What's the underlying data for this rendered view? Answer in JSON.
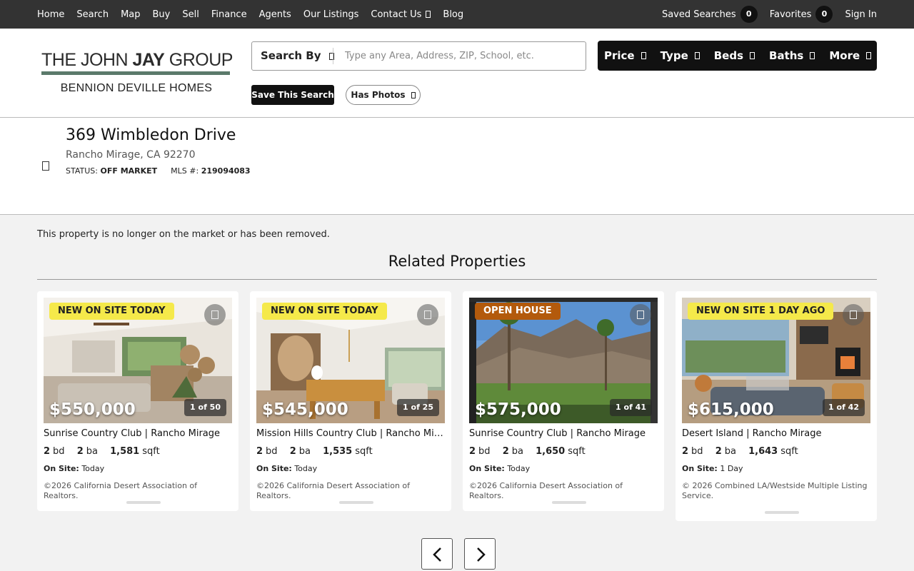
{
  "topnav": {
    "links": [
      "Home",
      "Search",
      "Map",
      "Buy",
      "Sell",
      "Finance",
      "Agents",
      "Our Listings",
      "Contact Us",
      "Blog"
    ],
    "saved_searches_label": "Saved Searches",
    "saved_searches_count": "0",
    "favorites_label": "Favorites",
    "favorites_count": "0",
    "sign_in": "Sign In"
  },
  "logo": {
    "line1_a": "THE JOHN ",
    "line1_b": "JAY",
    "line1_c": " GROUP",
    "line2": "BENNION DEVILLE HOMES"
  },
  "search": {
    "by_label": "Search By",
    "placeholder": "Type any Area, Address, ZIP, School, etc.",
    "value": ""
  },
  "filters": [
    "Price",
    "Type",
    "Beds",
    "Baths",
    "More"
  ],
  "save_search_label": "Save This Search",
  "has_photos_label": "Has Photos",
  "property": {
    "address": "369 Wimbledon Drive",
    "city_line": "Rancho Mirage, CA 92270",
    "status_label": "STATUS:",
    "status_value": "OFF MARKET",
    "mls_label": "MLS #:",
    "mls_value": "219094083"
  },
  "removed_notice": "This property is no longer on the market or has been removed.",
  "related_title": "Related Properties",
  "cards": [
    {
      "tag": "NEW ON SITE TODAY",
      "tag_color": "#f5e94a",
      "tag_text_color": "#222222",
      "price": "$550,000",
      "photo_count": "1 of 50",
      "name": "Sunrise Country Club | Rancho Mirage",
      "beds": "2",
      "beds_unit": "bd",
      "baths": "2",
      "baths_unit": "ba",
      "sqft": "1,581",
      "sqft_unit": "sqft",
      "onsite_label": "On Site:",
      "onsite_value": "Today",
      "copyright": "©2026 California Desert Association of Realtors."
    },
    {
      "tag": "NEW ON SITE TODAY",
      "tag_color": "#f5e94a",
      "tag_text_color": "#222222",
      "price": "$545,000",
      "photo_count": "1 of 25",
      "name": "Mission Hills Country Club | Rancho Mirage",
      "beds": "2",
      "beds_unit": "bd",
      "baths": "2",
      "baths_unit": "ba",
      "sqft": "1,535",
      "sqft_unit": "sqft",
      "onsite_label": "On Site:",
      "onsite_value": "Today",
      "copyright": "©2026 California Desert Association of Realtors."
    },
    {
      "tag": "OPEN HOUSE",
      "tag_color": "#b35a0c",
      "tag_text_color": "#ffffff",
      "price": "$575,000",
      "photo_count": "1 of 41",
      "name": "Sunrise Country Club | Rancho Mirage",
      "beds": "2",
      "beds_unit": "bd",
      "baths": "2",
      "baths_unit": "ba",
      "sqft": "1,650",
      "sqft_unit": "sqft",
      "onsite_label": "On Site:",
      "onsite_value": "Today",
      "copyright": "©2026 California Desert Association of Realtors."
    },
    {
      "tag": "NEW ON SITE 1 DAY AGO",
      "tag_color": "#f5e94a",
      "tag_text_color": "#222222",
      "price": "$615,000",
      "photo_count": "1 of 42",
      "name": "Desert Island | Rancho Mirage",
      "beds": "2",
      "beds_unit": "bd",
      "baths": "2",
      "baths_unit": "ba",
      "sqft": "1,643",
      "sqft_unit": "sqft",
      "onsite_label": "On Site:",
      "onsite_value": "1 Day",
      "copyright": "© 2026 Combined LA/Westside Multiple Listing Service."
    }
  ]
}
